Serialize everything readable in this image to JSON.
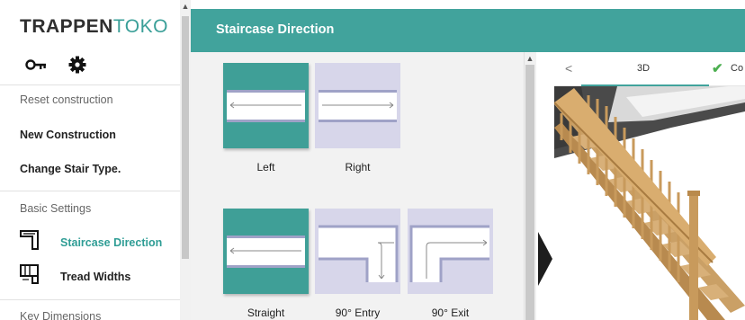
{
  "brand": {
    "part1": "TRAPPEN",
    "part2": "TOKO"
  },
  "sidebar": {
    "reset": "Reset construction",
    "new_construction": "New Construction",
    "change_stair": "Change Stair Type.",
    "basic_settings": "Basic Settings",
    "staircase_direction": "Staircase Direction",
    "tread_widths": "Tread Widths",
    "key_dimensions": "Key Dimensions"
  },
  "header": {
    "title": "Staircase Direction"
  },
  "options": [
    {
      "label": "Left",
      "selected": true
    },
    {
      "label": "Right",
      "selected": false
    },
    {
      "label": "Straight",
      "selected": true
    },
    {
      "label": "90° Entry",
      "selected": false
    },
    {
      "label": "90° Exit",
      "selected": false
    }
  ],
  "preview": {
    "back": "<",
    "tab_3d": "3D",
    "tab_check": "✔",
    "tab_co": "Co"
  },
  "colors": {
    "accent": "#41a39c",
    "tile_selected": "#3f9f97",
    "tile_default": "#d7d6ea",
    "brand_dark": "#2f2f2f"
  }
}
